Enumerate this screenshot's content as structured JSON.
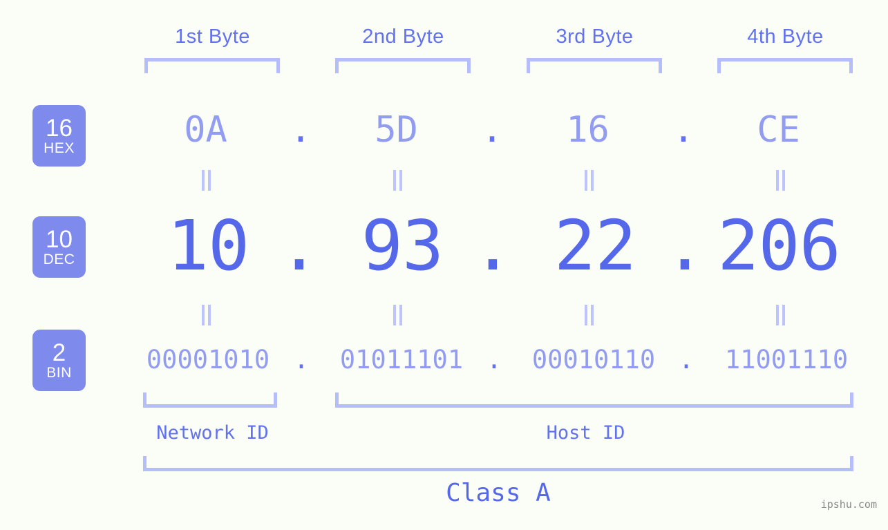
{
  "headers": {
    "bytes": [
      "1st Byte",
      "2nd Byte",
      "3rd Byte",
      "4th Byte"
    ]
  },
  "bases": [
    {
      "number": "16",
      "name": "HEX"
    },
    {
      "number": "10",
      "name": "DEC"
    },
    {
      "number": "2",
      "name": "BIN"
    }
  ],
  "separator": ".",
  "rows": {
    "hex": {
      "label": "HEX",
      "base": "16",
      "octets": [
        "0A",
        "5D",
        "16",
        "CE"
      ]
    },
    "dec": {
      "label": "DEC",
      "base": "10",
      "octets": [
        "10",
        "93",
        "22",
        "206"
      ]
    },
    "bin": {
      "label": "BIN",
      "base": "2",
      "octets": [
        "00001010",
        "01011101",
        "00010110",
        "11001110"
      ]
    }
  },
  "equality_symbol": "=",
  "segments": {
    "network_id": "Network ID",
    "host_id": "Host ID",
    "class": "Class A"
  },
  "watermark": "ipshu.com",
  "colors": {
    "background": "#fbfdf7",
    "badge_background": "#7e8aec",
    "badge_text": "#ffffff",
    "header_text": "#6272ee",
    "bracket": "#b5bdfb",
    "hex_text": "#929df2",
    "dec_text": "#5668ea",
    "bin_text": "#929df2",
    "label_text": "#6272ee",
    "watermark_text": "#8a8a8a"
  }
}
